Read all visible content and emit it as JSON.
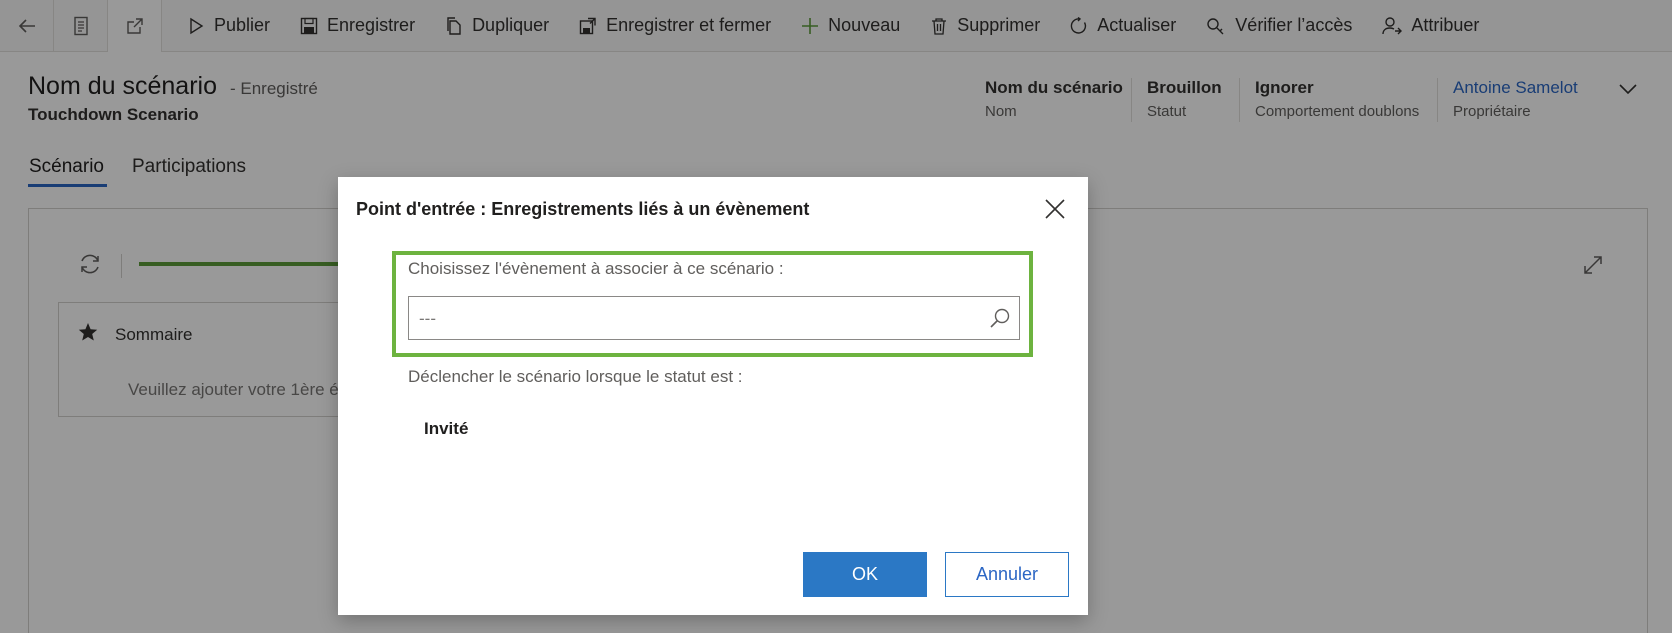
{
  "toolbar": {
    "items": [
      {
        "label": "Publier",
        "icon": "play-icon"
      },
      {
        "label": "Enregistrer",
        "icon": "save-icon"
      },
      {
        "label": "Dupliquer",
        "icon": "copy-icon"
      },
      {
        "label": "Enregistrer et fermer",
        "icon": "save-close-icon"
      },
      {
        "label": "Nouveau",
        "icon": "plus-icon"
      },
      {
        "label": "Supprimer",
        "icon": "trash-icon"
      },
      {
        "label": "Actualiser",
        "icon": "refresh-icon"
      },
      {
        "label": "Vérifier l’accès",
        "icon": "access-check-icon"
      },
      {
        "label": "Attribuer",
        "icon": "assign-user-icon"
      }
    ]
  },
  "header": {
    "title": "Nom du scénario",
    "state": "- Enregistré",
    "subtitle": "Touchdown Scenario",
    "fields": [
      {
        "value": "Nom du scénario",
        "label": "Nom"
      },
      {
        "value": "Brouillon",
        "label": "Statut"
      },
      {
        "value": "Ignorer",
        "label": "Comportement doublons"
      },
      {
        "value": "Antoine Samelot",
        "label": "Propriétaire"
      }
    ]
  },
  "tabs": [
    {
      "label": "Scénario"
    },
    {
      "label": "Participations"
    }
  ],
  "background": {
    "summary_title": "Sommaire",
    "summary_hint": "Veuillez ajouter votre 1ère é"
  },
  "dialog": {
    "title": "Point d'entrée : Enregistrements liés à un évènement",
    "event_label": "Choisissez l'évènement à associer à ce scénario :",
    "event_placeholder": "---",
    "trigger_label": "Déclencher le scénario lorsque le statut est :",
    "status_value": "Invité",
    "ok_label": "OK",
    "cancel_label": "Annuler"
  },
  "colors": {
    "accent": "#2b78c5",
    "highlight": "#6db33f",
    "progress": "#5d9b3a",
    "link": "#2b66c4"
  }
}
